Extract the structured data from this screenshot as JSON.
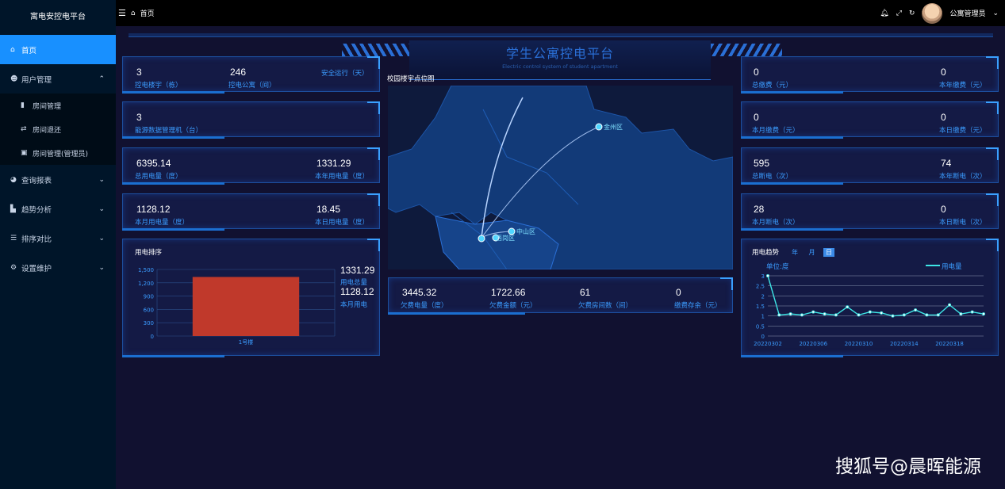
{
  "app": {
    "logo": "寓电安控电平台",
    "breadcrumb": "首页"
  },
  "nav": {
    "home": "首页",
    "user": "用户管理",
    "room": "房间管理",
    "checkout": "房间退还",
    "room_admin": "房间管理(管理员)",
    "report": "查询报表",
    "trend": "趋势分析",
    "rank": "排序对比",
    "settings": "设置维护"
  },
  "header": {
    "user": "公寓管理员"
  },
  "title": {
    "main": "学生公寓控电平台",
    "sub": "Electric control system of student apartment"
  },
  "stats": {
    "buildings": {
      "v": "3",
      "l": "控电楼宇（栋）"
    },
    "apartments": {
      "v": "246",
      "l": "控电公寓（间）"
    },
    "safe": {
      "l": "安全运行（天）"
    },
    "energy_mgr": {
      "v": "3",
      "l": "能源数据管理机（台）"
    },
    "total_use": {
      "v": "6395.14",
      "l": "总用电量（度）"
    },
    "year_use": {
      "v": "1331.29",
      "l": "本年用电量（度）"
    },
    "month_use": {
      "v": "1128.12",
      "l": "本月用电量（度）"
    },
    "day_use": {
      "v": "18.45",
      "l": "本日用电量（度）"
    },
    "total_pay": {
      "v": "0",
      "l": "总缴费（元）"
    },
    "year_pay": {
      "v": "0",
      "l": "本年缴费（元）"
    },
    "month_pay": {
      "v": "0",
      "l": "本月缴费（元）"
    },
    "day_pay": {
      "v": "0",
      "l": "本日缴费（元）"
    },
    "total_cut": {
      "v": "595",
      "l": "总断电（次）"
    },
    "year_cut": {
      "v": "74",
      "l": "本年断电（次）"
    },
    "month_cut": {
      "v": "28",
      "l": "本月断电（次）"
    },
    "day_cut": {
      "v": "0",
      "l": "本日断电（次）"
    },
    "owe_power": {
      "v": "3445.32",
      "l": "欠费电量（度）"
    },
    "owe_money": {
      "v": "1722.66",
      "l": "欠费金额（元）"
    },
    "owe_rooms": {
      "v": "61",
      "l": "欠费房间数（间）"
    },
    "balance": {
      "v": "0",
      "l": "缴费存余（元）"
    }
  },
  "map": {
    "title": "校园楼宇点位图",
    "labels": {
      "jinzhou": "金州区",
      "zhongshan": "中山区",
      "xigang": "西岗区"
    }
  },
  "rank_panel": {
    "title": "用电排序",
    "total_label": "用电总量",
    "total": "1331.29",
    "month_label": "本月用电",
    "month": "1128.12"
  },
  "trend_panel": {
    "title": "用电趋势",
    "tab_year": "年",
    "tab_month": "月",
    "tab_day": "日",
    "unit": "单位:度",
    "legend": "用电量"
  },
  "watermark": "搜狐号@晨晖能源",
  "chart_data": [
    {
      "type": "bar",
      "title": "用电排序",
      "categories": [
        "1号楼"
      ],
      "series": [
        {
          "values": [
            1331.29
          ]
        }
      ],
      "yticks": [
        "0",
        "300",
        "600",
        "900",
        "1,200",
        "1,500"
      ],
      "ylim": [
        0,
        1500
      ],
      "bar_color": "#c0392b"
    },
    {
      "type": "line",
      "title": "用电趋势",
      "ylabel": "单位:度",
      "ylim": [
        0,
        3
      ],
      "yticks": [
        "0",
        "0.5",
        "1",
        "1.5",
        "2",
        "2.5",
        "3"
      ],
      "x": [
        "20220302",
        "20220303",
        "20220304",
        "20220305",
        "20220306",
        "20220307",
        "20220308",
        "20220309",
        "20220310",
        "20220311",
        "20220312",
        "20220313",
        "20220314",
        "20220315",
        "20220316",
        "20220317",
        "20220318",
        "20220319",
        "20220320",
        "20220321"
      ],
      "xticks": [
        "20220302",
        "20220306",
        "20220310",
        "20220314",
        "20220318"
      ],
      "series": [
        {
          "name": "用电量",
          "values": [
            3,
            1.05,
            1.1,
            1.05,
            1.2,
            1.1,
            1.05,
            1.45,
            1.05,
            1.2,
            1.15,
            1.0,
            1.05,
            1.3,
            1.05,
            1.05,
            1.55,
            1.1,
            1.2,
            1.1
          ]
        }
      ],
      "line_color": "#3ee6e6"
    }
  ]
}
